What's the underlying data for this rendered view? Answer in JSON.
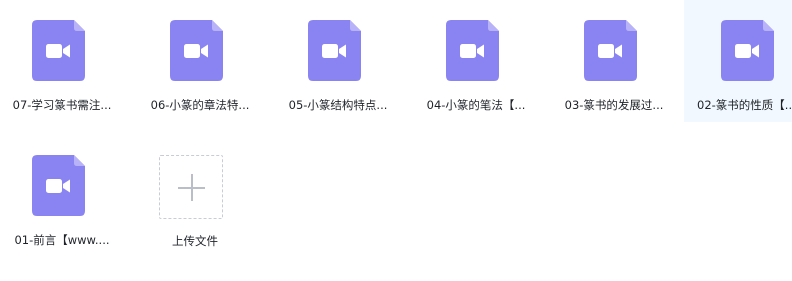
{
  "colors": {
    "video_icon_body": "#8a84f2",
    "video_icon_fold": "#b8b3f8",
    "hover_bg": "#f2f8ff",
    "text": "#1f2329"
  },
  "files": [
    {
      "name": "07-学习篆书需注...",
      "icon": "video-file-icon"
    },
    {
      "name": "06-小篆的章法特...",
      "icon": "video-file-icon"
    },
    {
      "name": "05-小篆结构特点...",
      "icon": "video-file-icon"
    },
    {
      "name": "04-小篆的笔法【...",
      "icon": "video-file-icon"
    },
    {
      "name": "03-篆书的发展过...",
      "icon": "video-file-icon"
    },
    {
      "name": "02-篆书的性质【...",
      "icon": "video-file-icon"
    },
    {
      "name": "01-前言【www....",
      "icon": "video-file-icon"
    }
  ],
  "upload": {
    "label": "上传文件",
    "icon": "plus-icon"
  }
}
